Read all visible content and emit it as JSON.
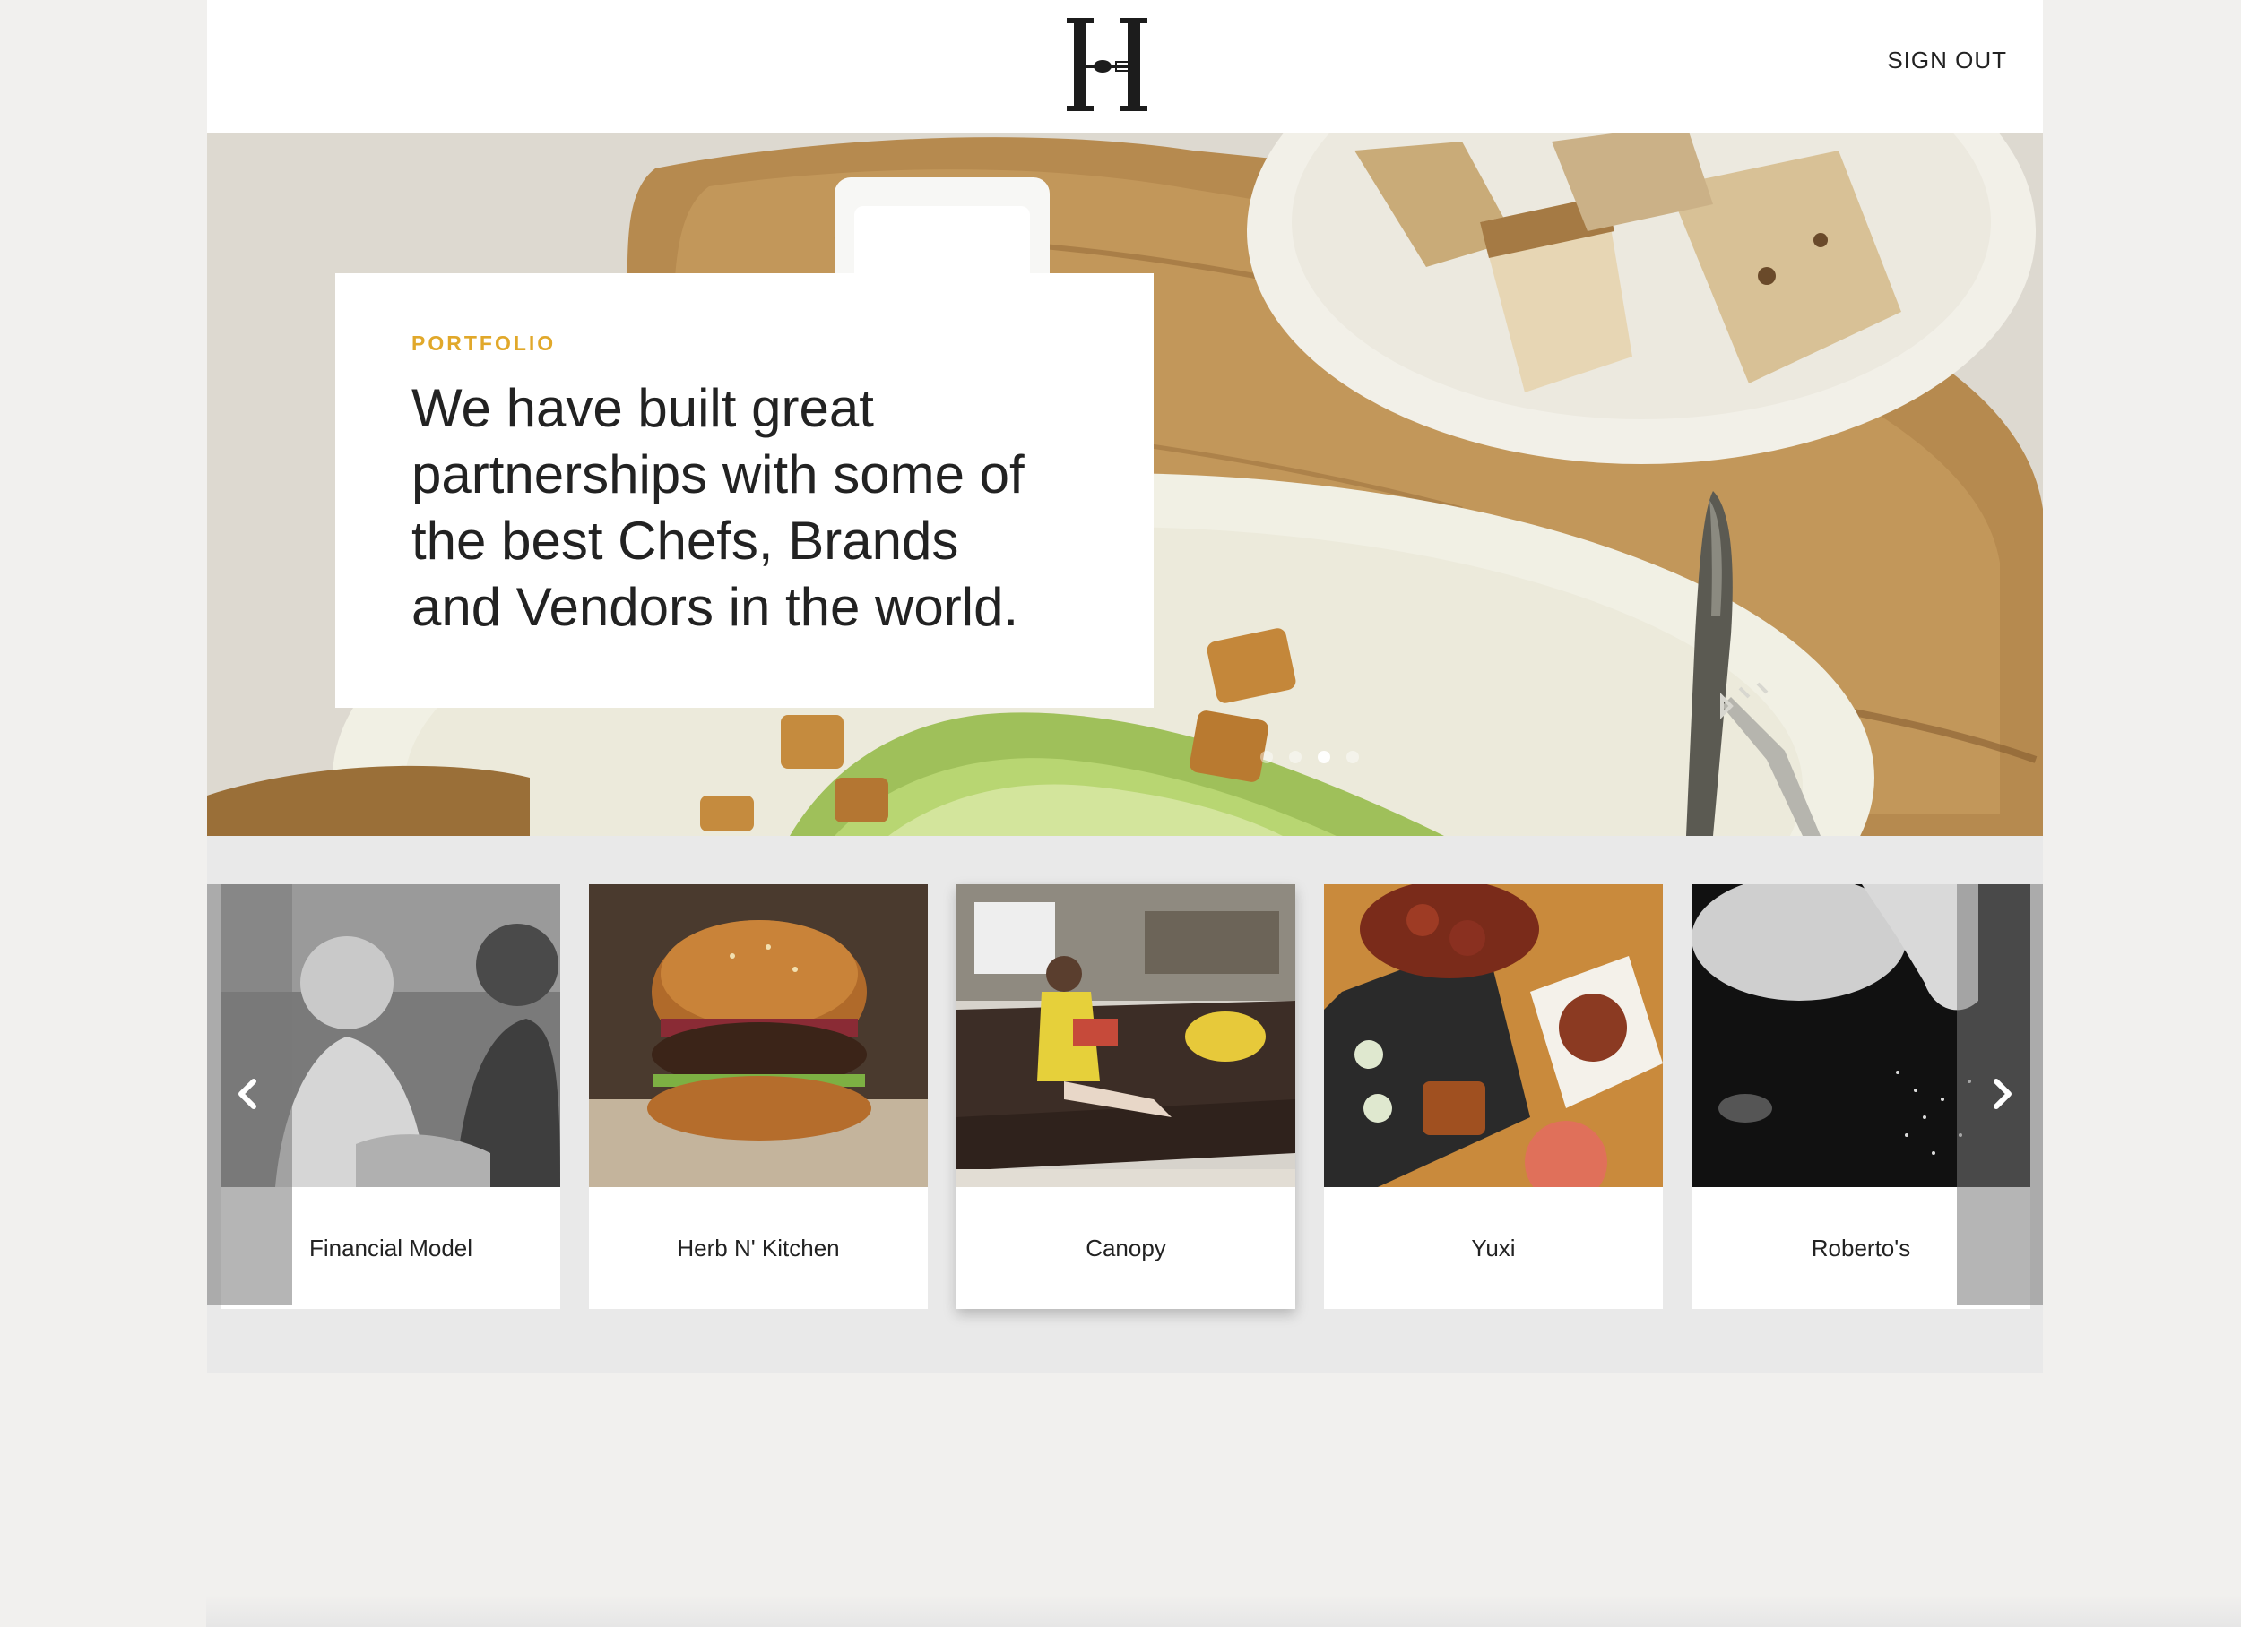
{
  "header": {
    "logo_icon": "H-fork-knife-logo",
    "signout_label": "SIGN OUT"
  },
  "hero": {
    "eyebrow": "PORTFOLIO",
    "headline": "We have built great partnerships with some of the best Chefs, Brands and Vendors in the world.",
    "dots": [
      false,
      false,
      true,
      false
    ],
    "image": "salad-bread-board-photo"
  },
  "carousel": {
    "prev_icon": "chevron-left-icon",
    "next_icon": "chevron-right-icon",
    "items": [
      {
        "label": "Financial Model",
        "image": "people-meeting-photo"
      },
      {
        "label": "Herb N' Kitchen",
        "image": "burger-photo"
      },
      {
        "label": "Canopy",
        "image": "woman-on-sofa-photo"
      },
      {
        "label": "Yuxi",
        "image": "asian-dishes-photo"
      },
      {
        "label": "Roberto's",
        "image": "chef-salting-photo"
      }
    ]
  },
  "colors": {
    "accent": "#e1a82a",
    "background": "#f1f0ee",
    "band": "#e9e9e9"
  }
}
